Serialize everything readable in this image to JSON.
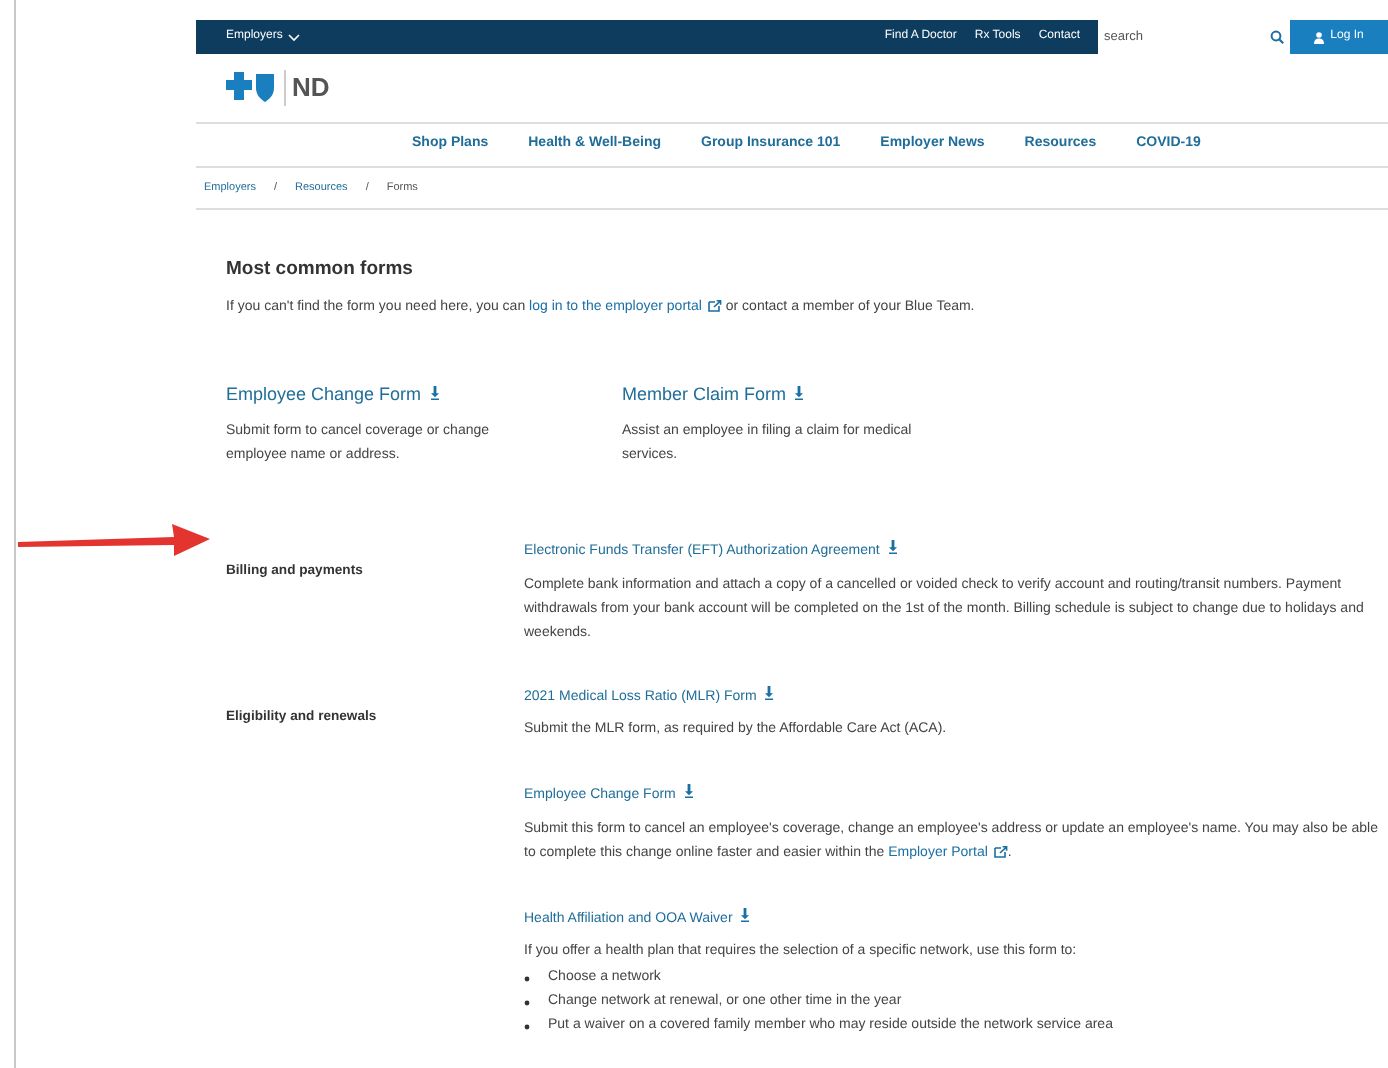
{
  "top_bar": {
    "audience_menu": "Employers",
    "links": [
      "Find A Doctor",
      "Rx Tools",
      "Contact"
    ],
    "search": {
      "placeholder": "search"
    },
    "login": "Log In"
  },
  "logo": {
    "text": "ND"
  },
  "nav": [
    "Shop Plans",
    "Health & Well-Being",
    "Group Insurance 101",
    "Employer News",
    "Resources",
    "COVID-19"
  ],
  "breadcrumb": [
    "Employers",
    "/",
    "Resources",
    "/",
    "Forms"
  ],
  "common_forms": {
    "heading": "Most common forms",
    "intro_before": "If you can't find the form you need here, you can ",
    "intro_link": "log in to the employer portal",
    "intro_after": " or contact a member of your Blue Team.",
    "forms": [
      {
        "title": "Employee Change Form",
        "description": "Submit form to cancel coverage or change employee name or address."
      },
      {
        "title": "Member Claim Form",
        "description": "Assist an employee in filing a claim for medical services."
      }
    ]
  },
  "sections": [
    {
      "label": "Billing and payments",
      "annotated": true,
      "forms": [
        {
          "title": "Electronic Funds Transfer (EFT) Authorization Agreement",
          "description": "Complete bank information and attach a copy of a cancelled or voided check to verify account and routing/transit numbers. Payment withdrawals from your bank account will be completed on the 1st of the month. Billing schedule is subject to change due to holidays and weekends."
        }
      ]
    },
    {
      "label": "Eligibility and renewals",
      "annotated": false,
      "forms": [
        {
          "title": "2021 Medical Loss Ratio (MLR) Form",
          "description": "Submit the MLR form, as required by the Affordable Care Act (ACA)."
        },
        {
          "title": "Employee Change Form",
          "description": "Submit this form to cancel an employee's coverage, change an employee's address or update an employee's name. You may also be able to complete this change online faster and easier within the ",
          "link": "Employer Portal",
          "after": "."
        },
        {
          "title": "Health Affiliation and OOA Waiver",
          "description": "If you offer a health plan that requires the selection of a specific network, use this form to:",
          "bullets": [
            "Choose a network",
            "Change network at renewal, or one other time in the year",
            "Put a waiver on a covered family member who may reside outside the network service area"
          ]
        }
      ]
    }
  ]
}
